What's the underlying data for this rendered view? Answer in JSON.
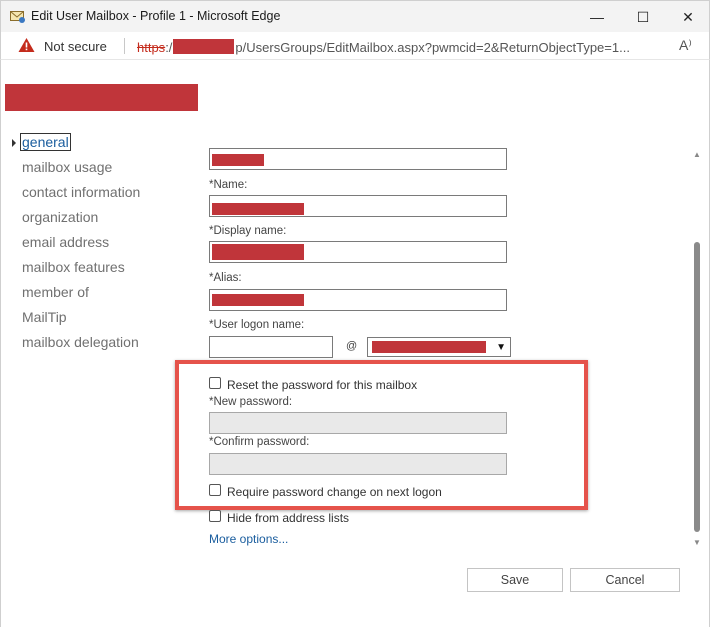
{
  "window": {
    "title": "Edit User Mailbox - Profile 1 - Microsoft Edge",
    "minimize_icon": "—",
    "maximize_icon": "☐",
    "close_icon": "✕"
  },
  "address_bar": {
    "security_label": "Not secure",
    "url_scheme": "https",
    "url_sep": ":/",
    "url_rest": "p/UsersGroups/EditMailbox.aspx?pwmcid=2&ReturnObjectType=1...",
    "read_aloud_icon": "A⁾"
  },
  "nav": {
    "items": [
      {
        "label": "general",
        "active": true
      },
      {
        "label": "mailbox usage"
      },
      {
        "label": "contact information"
      },
      {
        "label": "organization"
      },
      {
        "label": "email address"
      },
      {
        "label": "mailbox features"
      },
      {
        "label": "member of"
      },
      {
        "label": "MailTip"
      },
      {
        "label": "mailbox delegation"
      }
    ]
  },
  "form": {
    "name_label": "*Name:",
    "display_name_label": "*Display name:",
    "alias_label": "*Alias:",
    "logon_name_label": "*User logon name:",
    "at_sign": "@",
    "domain_caret": "▼",
    "reset_password_label": "Reset the password for this mailbox",
    "new_password_label": "*New password:",
    "confirm_password_label": "*Confirm password:",
    "require_change_label": "Require password change on next logon",
    "hide_from_lists_label": "Hide from address lists",
    "more_options_link": "More options..."
  },
  "scrollbar": {
    "up_icon": "▲",
    "down_icon": "▼"
  },
  "buttons": {
    "save": "Save",
    "cancel": "Cancel"
  },
  "colors": {
    "redaction": "#c0353a",
    "highlight": "#e5534b",
    "link": "#1a5d9e"
  }
}
